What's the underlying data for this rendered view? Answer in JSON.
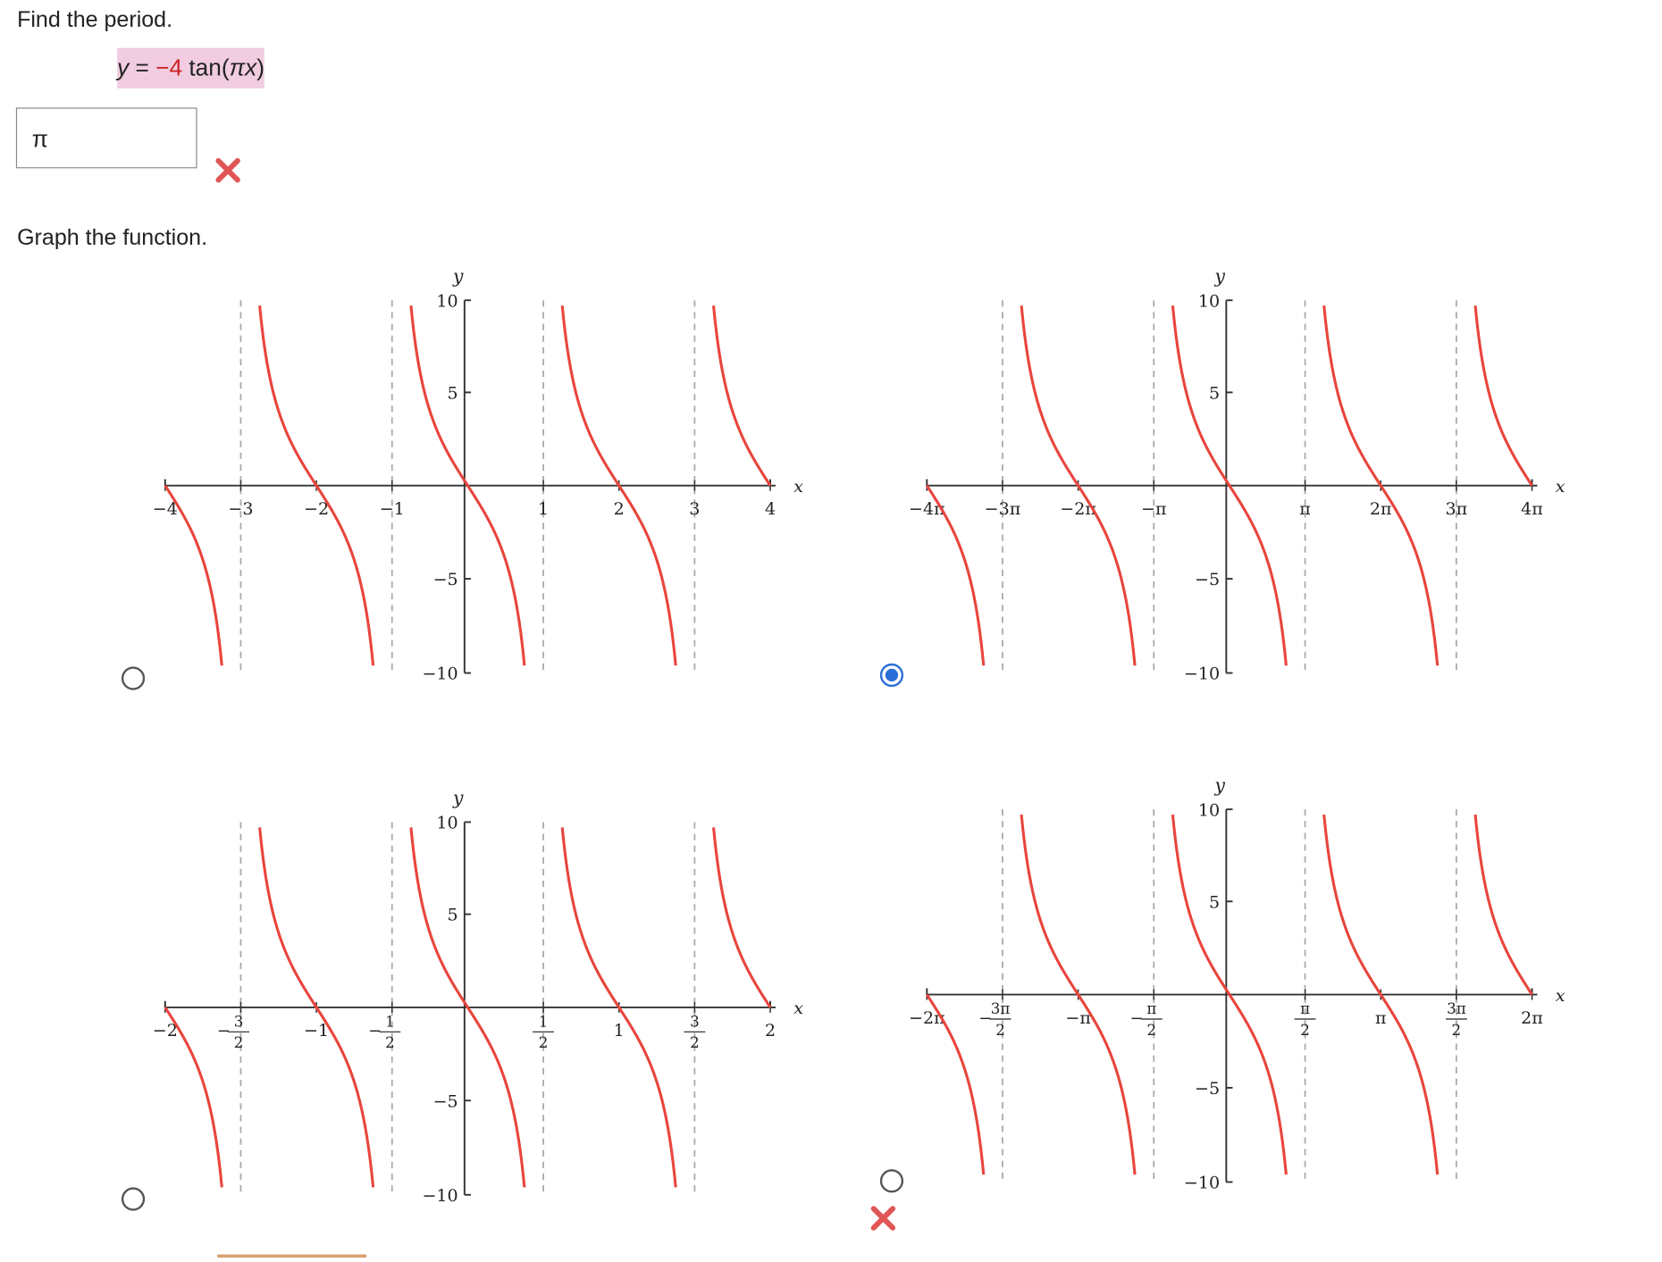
{
  "question1": {
    "prompt": "Find the period.",
    "equation": {
      "y": "y",
      "eq": " = ",
      "coef": "−4",
      "func": " tan(",
      "arg": "πx",
      "close": ")"
    },
    "answer_value": "π",
    "status_icon": "incorrect-x-icon"
  },
  "question2": {
    "prompt": "Graph the function.",
    "status_icon": "incorrect-x-icon",
    "options": [
      {
        "id": "A",
        "selected": false,
        "x_label": "x",
        "y_label": "y",
        "y_ticks": [
          "10",
          "5",
          "−5",
          "−10"
        ],
        "x_ticks": [
          {
            "num": "−4"
          },
          {
            "num": "−3"
          },
          {
            "num": "−2"
          },
          {
            "num": "−1"
          },
          {
            "num": "1"
          },
          {
            "num": "2"
          },
          {
            "num": "3"
          },
          {
            "num": "4"
          }
        ]
      },
      {
        "id": "B",
        "selected": true,
        "x_label": "x",
        "y_label": "y",
        "y_ticks": [
          "10",
          "5",
          "−5",
          "−10"
        ],
        "x_ticks": [
          {
            "num": "−4π"
          },
          {
            "num": "−3π"
          },
          {
            "num": "−2π"
          },
          {
            "num": "−π"
          },
          {
            "num": "π"
          },
          {
            "num": "2π"
          },
          {
            "num": "3π"
          },
          {
            "num": "4π"
          }
        ]
      },
      {
        "id": "C",
        "selected": false,
        "x_label": "x",
        "y_label": "y",
        "y_ticks": [
          "10",
          "5",
          "−5",
          "−10"
        ],
        "x_ticks": [
          {
            "num": "−2"
          },
          {
            "num": "3",
            "den": "2",
            "neg": true
          },
          {
            "num": "−1"
          },
          {
            "num": "1",
            "den": "2",
            "neg": true
          },
          {
            "num": "1",
            "den": "2"
          },
          {
            "num": "1"
          },
          {
            "num": "3",
            "den": "2"
          },
          {
            "num": "2"
          }
        ]
      },
      {
        "id": "D",
        "selected": false,
        "x_label": "x",
        "y_label": "y",
        "y_ticks": [
          "10",
          "5",
          "−5",
          "−10"
        ],
        "x_ticks": [
          {
            "num": "−2π"
          },
          {
            "num": "3π",
            "den": "2",
            "neg": true
          },
          {
            "num": "−π"
          },
          {
            "num": "π",
            "den": "2",
            "neg": true
          },
          {
            "num": "π",
            "den": "2"
          },
          {
            "num": "π"
          },
          {
            "num": "3π",
            "den": "2"
          },
          {
            "num": "2π"
          }
        ]
      }
    ]
  },
  "colors": {
    "curve": "#e8453c",
    "axis": "#333333",
    "asymptote": "#aaaaaa",
    "highlight": "#f2cce0",
    "error": "#e05555",
    "radio_selected": "#2b6fd6"
  }
}
